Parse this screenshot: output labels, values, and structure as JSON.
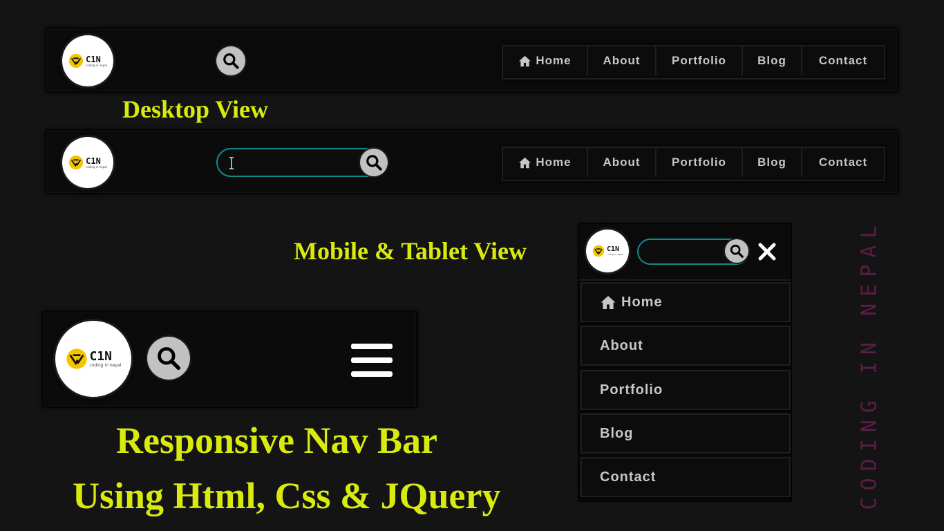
{
  "brand": {
    "logo_text": "C1N",
    "logo_tagline": "coding in nepal"
  },
  "desktop_view_label": "Desktop View",
  "mobile_view_label": "Mobile & Tablet View",
  "nav": {
    "items": [
      {
        "label": "Home",
        "icon": "home-icon"
      },
      {
        "label": "About"
      },
      {
        "label": "Portfolio"
      },
      {
        "label": "Blog"
      },
      {
        "label": "Contact"
      }
    ]
  },
  "search": {
    "value": "",
    "placeholder": ""
  },
  "title_line1": "Responsive Nav Bar",
  "title_line2": "Using Html, Css & JQuery",
  "watermark": "CODING IN NEPAL",
  "colors": {
    "background": "#141414",
    "navbar": "#0b0b0b",
    "nav_text": "#c7c7c7",
    "heading": "#d9ea0e",
    "search_border": "#138a8a",
    "search_button": "#c3c0c0",
    "logo_accent": "#f5c400",
    "watermark": "#5a1d48"
  }
}
